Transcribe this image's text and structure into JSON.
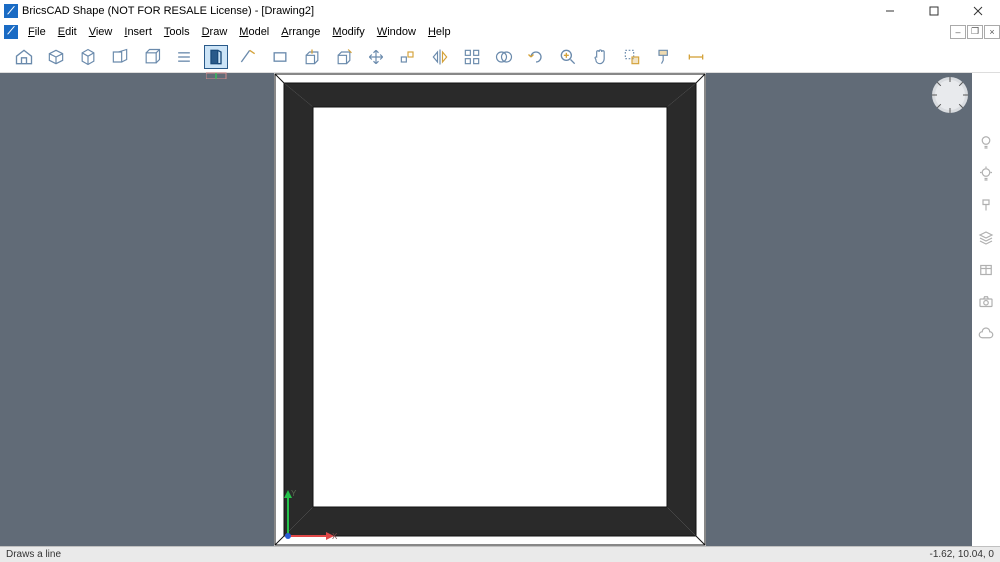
{
  "title": "BricsCAD Shape (NOT FOR RESALE License) - [Drawing2]",
  "menu": {
    "file": {
      "label": "File",
      "accel": "F"
    },
    "edit": {
      "label": "Edit",
      "accel": "E"
    },
    "view": {
      "label": "View",
      "accel": "V"
    },
    "insert": {
      "label": "Insert",
      "accel": "I"
    },
    "tools": {
      "label": "Tools",
      "accel": "T"
    },
    "draw": {
      "label": "Draw",
      "accel": "D"
    },
    "model": {
      "label": "Model",
      "accel": "M"
    },
    "arrange": {
      "label": "Arrange",
      "accel": "A"
    },
    "modify": {
      "label": "Modify",
      "accel": "M"
    },
    "window": {
      "label": "Window",
      "accel": "W"
    },
    "help": {
      "label": "Help",
      "accel": "H"
    }
  },
  "toolbar_icons": [
    "home",
    "cube-solid",
    "cube-wire",
    "layout",
    "box",
    "list",
    "wall",
    "line",
    "rect",
    "pushpull",
    "extrude",
    "move-3d",
    "array-3d",
    "mirror",
    "grid",
    "boolean",
    "rotate",
    "zoom-fit",
    "pan",
    "select-region",
    "paint",
    "measure"
  ],
  "active_tool_index": 6,
  "right_panel_icons": [
    "bulb-off",
    "bulb-on",
    "brush",
    "layers",
    "structure",
    "camera",
    "cloud"
  ],
  "status": {
    "hint": "Draws a line",
    "coords": "-1.62, 10.04, 0"
  },
  "axis": {
    "x_label": "X",
    "y_label": "Y"
  }
}
